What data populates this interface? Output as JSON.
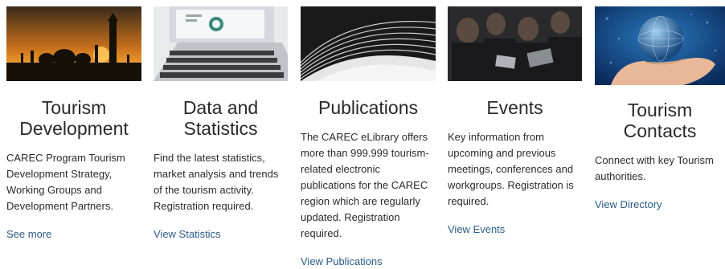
{
  "cards": [
    {
      "title": "Tourism Development",
      "desc": "CAREC Program Tourism Development Strategy, Working Groups and Development Partners.",
      "link": "See more",
      "image": "mosque-sunset-image"
    },
    {
      "title": "Data and Statistics",
      "desc": "Find the latest statistics, market analysis and trends of the tourism activity. Registration required.",
      "link": "View Statistics",
      "image": "laptop-charts-image"
    },
    {
      "title": "Publications",
      "desc": "The CAREC eLibrary offers more than 999.999 tourism-related electronic publications for the CAREC region which are regularly updated. Registration required.",
      "link": "View Publications",
      "image": "book-pages-image"
    },
    {
      "title": "Events",
      "desc": "Key information from upcoming and previous meetings, conferences and workgroups. Registration is required.",
      "link": "View Events",
      "image": "conference-audience-image"
    },
    {
      "title": "Tourism Contacts",
      "desc": "Connect with key Tourism authorities.",
      "link": "View Directory",
      "image": "globe-in-hand-image"
    }
  ]
}
